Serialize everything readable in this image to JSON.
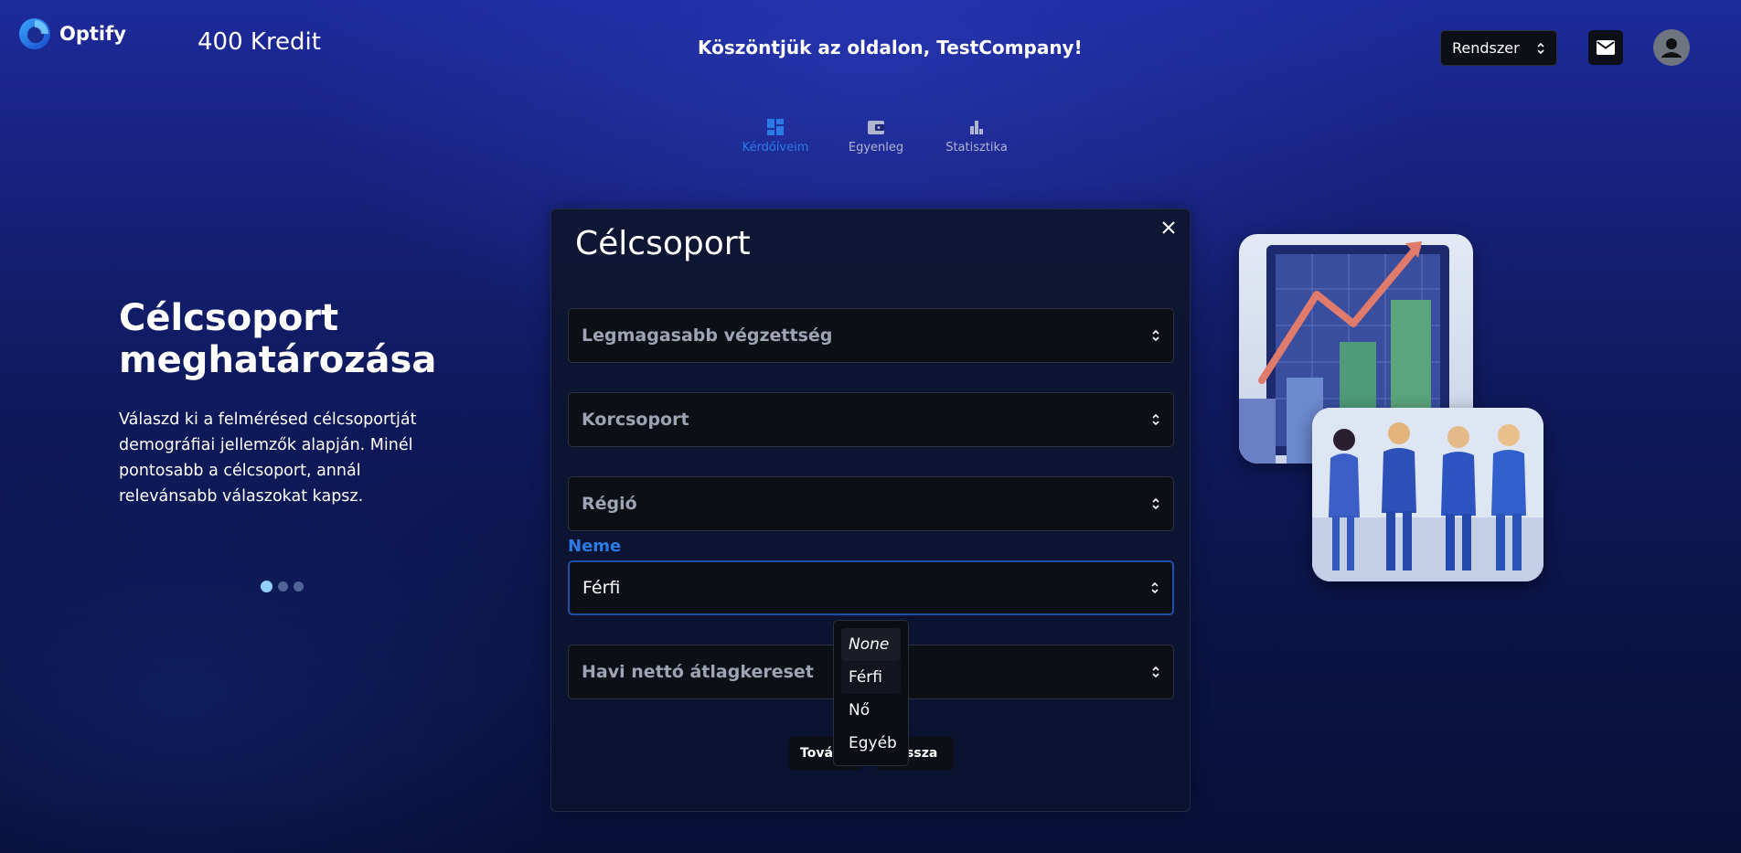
{
  "app": {
    "brand": "Optify",
    "credits": "400 Kredit",
    "welcome": "Köszöntjük az oldalon, TestCompany!",
    "theme_select": "Rendszer"
  },
  "tabs": [
    {
      "label": "Kérdőíveim",
      "icon": "dashboard-icon",
      "active": true
    },
    {
      "label": "Egyenleg",
      "icon": "wallet-icon",
      "active": false
    },
    {
      "label": "Statisztika",
      "icon": "bar-chart-icon",
      "active": false
    }
  ],
  "hero": {
    "title": "Célcsoport meghatározása",
    "text": "Válaszd ki a felmérésed célcsoportját demográfiai jellemzők alapján. Minél pontosabb a célcsoport, annál relevánsabb válaszokat kapsz.",
    "carousel_active_index": 0,
    "carousel_count": 3
  },
  "card": {
    "title": "Célcsoport",
    "fields": {
      "education": "Legmagasabb végzettség",
      "age_group": "Korcsoport",
      "region": "Régió",
      "gender_label": "Neme",
      "gender_value": "Férfi",
      "income": "Havi nettó átlagkereset"
    },
    "buttons": {
      "next": "Tovább",
      "back": "Vissza"
    }
  },
  "dropdown": {
    "options": [
      "None",
      "Férfi",
      "Nő",
      "Egyéb"
    ],
    "selected": "Férfi"
  },
  "colors": {
    "accent": "#2c7be5",
    "field_bg": "#0d0f16",
    "card_bg": "#0e1633"
  }
}
